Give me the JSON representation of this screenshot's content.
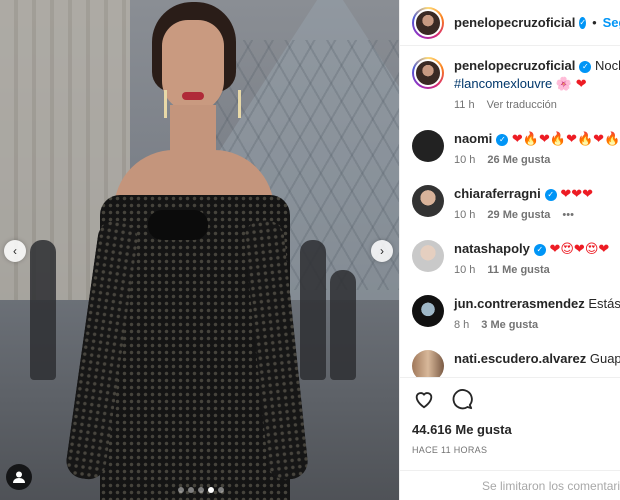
{
  "post": {
    "image_alt_icon": "photo",
    "carousel": {
      "count": 5,
      "active_index": 3
    }
  },
  "header": {
    "username": "penelopecruzoficial",
    "follow_label": "Seguir"
  },
  "caption": {
    "username": "penelopecruzoficial",
    "text": "Noche m",
    "hashtag": "#lancomexlouvre",
    "emojis": [
      "🌸",
      "❤"
    ],
    "time": "11 h",
    "translate_label": "Ver traducción"
  },
  "comments": [
    {
      "username": "naomi",
      "verified": true,
      "text": "❤🔥❤🔥❤🔥❤🔥",
      "time": "10 h",
      "likes": "26 Me gusta"
    },
    {
      "username": "chiaraferragni",
      "verified": true,
      "text": "❤❤❤",
      "time": "10 h",
      "likes": "29 Me gusta",
      "more": "•••"
    },
    {
      "username": "natashapoly",
      "verified": true,
      "text": "❤😍❤😍❤",
      "time": "10 h",
      "likes": "11 Me gusta"
    },
    {
      "username": "jun.contrerasmendez",
      "verified": false,
      "text": "Estás gua",
      "time": "8 h",
      "likes": "3 Me gusta"
    },
    {
      "username": "nati.escudero.alvarez",
      "verified": false,
      "text": "Guapísim",
      "time": "",
      "likes": ""
    }
  ],
  "actions": {
    "likes_count": "44.616 Me gusta",
    "timestamp": "HACE 11 HORAS"
  },
  "comments_disabled_note": "Se limitaron los comentarios",
  "colors": {
    "link": "#0095f6",
    "hashtag": "#00376b",
    "heart": "#ed1c24"
  }
}
